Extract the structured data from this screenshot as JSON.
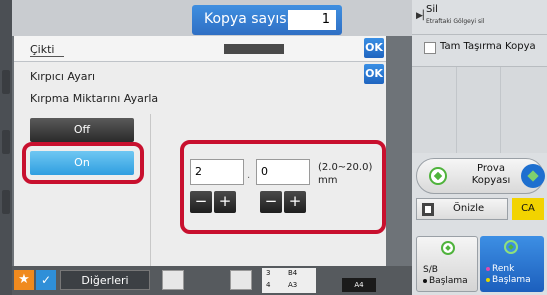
{
  "header": {
    "copies_label": "Kopya sayısı",
    "copies_value": "1"
  },
  "output_dialog": {
    "title": "Çikti",
    "ok_label": "OK"
  },
  "trim_dialog": {
    "title": "Kırpıcı Ayarı",
    "subtitle": "Kırpma Miktarını Ayarla",
    "ok_label": "OK",
    "off_label": "Off",
    "on_label": "On",
    "on_selected": true,
    "field_1_value": "2",
    "field_2_value": "0",
    "separator": ".",
    "range_text": "(2.0~20.0)",
    "unit": "mm",
    "minus_label": "−",
    "plus_label": "+"
  },
  "right_panel": {
    "erase_title": "Sil",
    "erase_subtitle": "Etraftaki Gölgeyi sil",
    "full_bleed_label": "Tam Taşırma Kopya",
    "proof_label_line1": "Prova",
    "proof_label_line2": "Kopyası",
    "preview_label": "Önizle",
    "ca_label": "CA",
    "bw_start_line1": "S/B",
    "bw_start_line2": "Başlama",
    "color_start_line1": "Renk",
    "color_start_line2": "Başlama"
  },
  "bottom_bar": {
    "star": "★",
    "check": "✓",
    "others_label": "Diğerleri",
    "tray_3": "3",
    "tray_4": "4",
    "size_b4": "B4",
    "size_a3": "A3",
    "size_a4": "A4"
  },
  "colors": {
    "accent_blue": "#2f6fc4",
    "highlight_red": "#c8102e",
    "ca_yellow": "#f2d300",
    "star_orange": "#f08a1e"
  }
}
